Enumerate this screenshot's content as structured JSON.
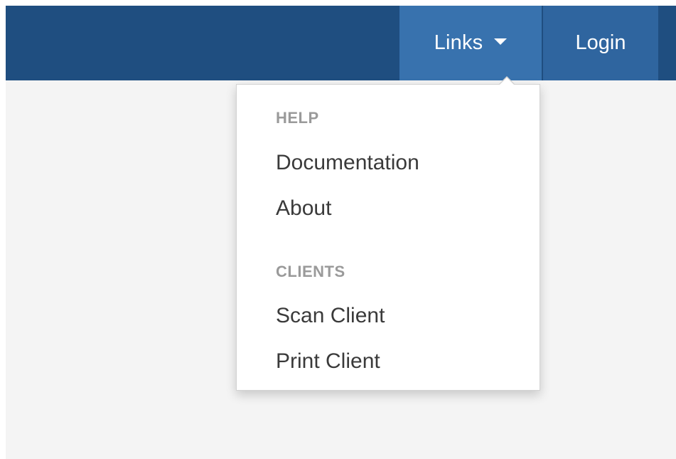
{
  "navbar": {
    "links_label": "Links",
    "login_label": "Login"
  },
  "dropdown": {
    "sections": [
      {
        "header": "HELP",
        "items": [
          "Documentation",
          "About"
        ]
      },
      {
        "header": "CLIENTS",
        "items": [
          "Scan Client",
          "Print Client"
        ]
      }
    ]
  },
  "colors": {
    "navbar_bg": "#1f4e80",
    "links_active_bg": "#3872ae",
    "login_bg": "#2f659f",
    "page_bg": "#f4f4f4",
    "header_text": "#9a9a9a",
    "item_text": "#3a3a3a"
  }
}
